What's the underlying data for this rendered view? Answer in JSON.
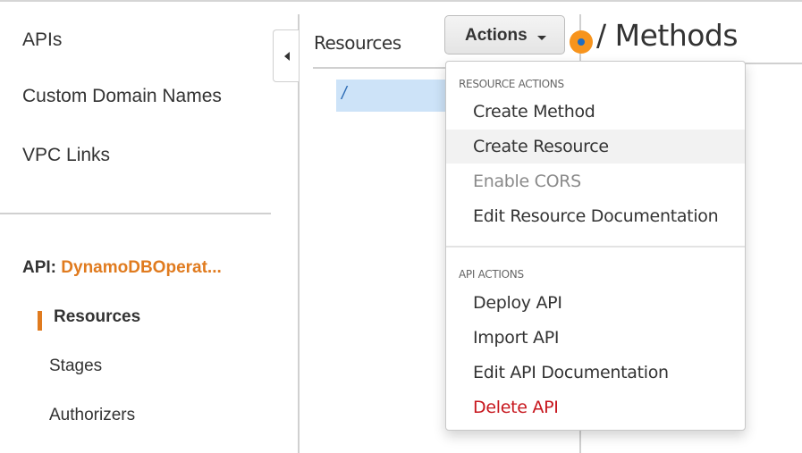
{
  "sidebar": {
    "nav": [
      {
        "label": "APIs"
      },
      {
        "label": "Custom Domain Names"
      },
      {
        "label": "VPC Links"
      }
    ],
    "api_prefix": "API:",
    "api_name": "DynamoDBOperat...",
    "sub_items": [
      {
        "label": "Resources",
        "active": true
      },
      {
        "label": "Stages"
      },
      {
        "label": "Authorizers"
      }
    ]
  },
  "resources": {
    "title": "Resources",
    "tree": [
      {
        "path": "/",
        "selected": true
      }
    ]
  },
  "actions_button": {
    "label": "Actions"
  },
  "methods": {
    "title": "/ Methods"
  },
  "dropdown": {
    "sections": [
      {
        "header": "RESOURCE ACTIONS",
        "items": [
          {
            "label": "Create Method"
          },
          {
            "label": "Create Resource",
            "hovered": true
          },
          {
            "label": "Enable CORS",
            "disabled": true
          },
          {
            "label": "Edit Resource Documentation"
          }
        ]
      },
      {
        "header": "API ACTIONS",
        "items": [
          {
            "label": "Deploy API"
          },
          {
            "label": "Import API"
          },
          {
            "label": "Edit API Documentation"
          },
          {
            "label": "Delete API",
            "danger": true
          }
        ]
      }
    ]
  },
  "colors": {
    "accent": "#e07b1f",
    "selection": "#cde3f8",
    "danger": "#c7161d",
    "indicator": "#f7941d"
  }
}
